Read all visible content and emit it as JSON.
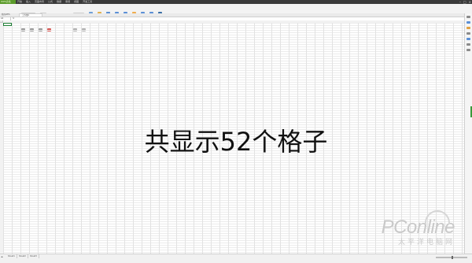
{
  "app": {
    "brand": "WPS表格",
    "menu": [
      "开始",
      "插入",
      "页面布局",
      "公式",
      "数据",
      "审阅",
      "视图",
      "开发工具"
    ],
    "doc_tab": "工作簿1",
    "home_tab": "我的WPS",
    "name_box": "A1",
    "fx_label": "fx"
  },
  "sheets": [
    "Sheet1",
    "Sheet2",
    "Sheet3"
  ],
  "caption": "共显示52个格子",
  "watermark": {
    "logo": "PConline",
    "sub": "太平洋电脑网"
  },
  "colors": {
    "accent": "#5a9a2a",
    "titlebar": "#3a3a3a",
    "active_cell": "#1e7e34"
  }
}
